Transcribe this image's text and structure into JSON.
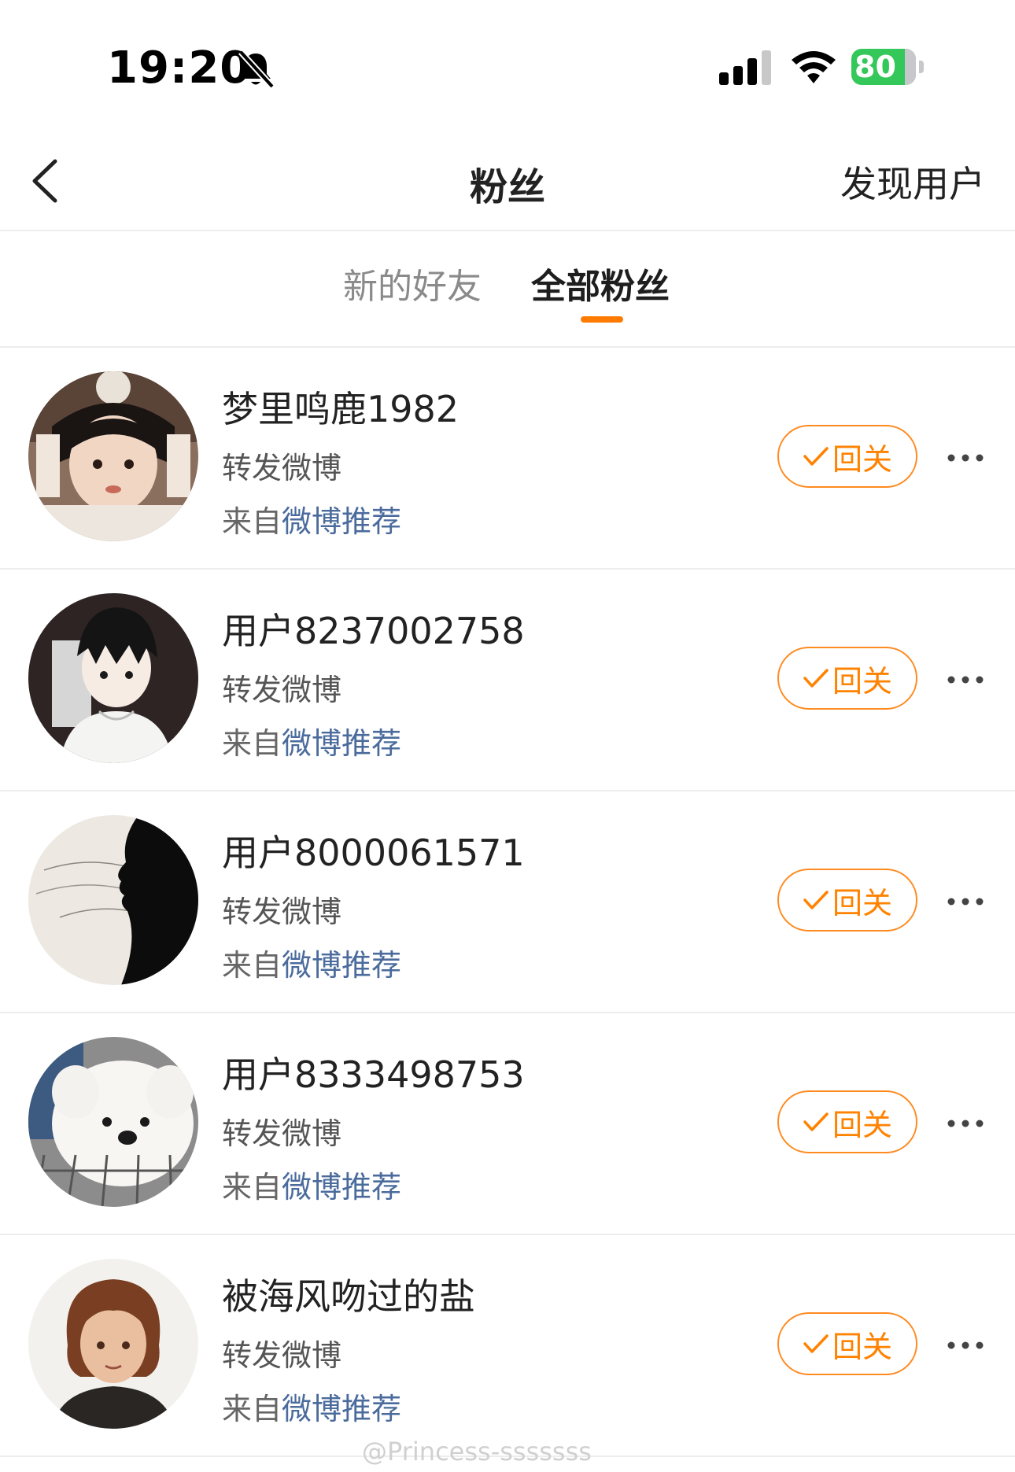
{
  "status_bar": {
    "time": "19:20",
    "battery": "80"
  },
  "header": {
    "title": "粉丝",
    "discover": "发现用户"
  },
  "tabs": [
    {
      "label": "新的好友",
      "active": false
    },
    {
      "label": "全部粉丝",
      "active": true
    }
  ],
  "fans": [
    {
      "name": "梦里鸣鹿1982",
      "action": "转发微博",
      "source_prefix": "来自",
      "source": "微博推荐",
      "button": "回关"
    },
    {
      "name": "用户8237002758",
      "action": "转发微博",
      "source_prefix": "来自",
      "source": "微博推荐",
      "button": "回关"
    },
    {
      "name": "用户8000061571",
      "action": "转发微博",
      "source_prefix": "来自",
      "source": "微博推荐",
      "button": "回关"
    },
    {
      "name": "用户8333498753",
      "action": "转发微博",
      "source_prefix": "来自",
      "source": "微博推荐",
      "button": "回关"
    },
    {
      "name": "被海风吻过的盐",
      "action": "转发微博",
      "source_prefix": "来自",
      "source": "微博推荐",
      "button": "回关"
    }
  ],
  "watermark": "@Princess-sssssss",
  "colors": {
    "accent": "#ff8200",
    "link": "#4a6b9c",
    "battery": "#34c759"
  }
}
